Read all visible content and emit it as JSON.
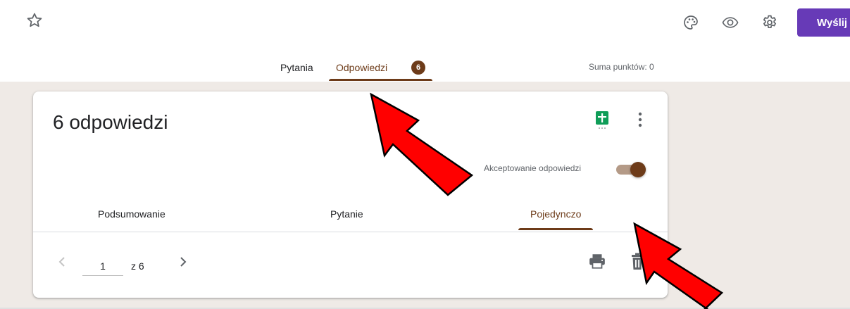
{
  "toolbar": {
    "send_label": "Wyślij",
    "icons": [
      "star-icon",
      "palette-icon",
      "eye-icon",
      "gear-icon"
    ],
    "accent_color": "#673ab7"
  },
  "tabs": {
    "questions_label": "Pytania",
    "responses_label": "Odpowiedzi",
    "responses_badge": "6",
    "points_label": "Suma punktów: 0",
    "theme_color": "#6d3b19"
  },
  "card": {
    "title": "6 odpowiedzi",
    "accepting_label": "Akceptowanie odpowiedzi",
    "accepting_on": true,
    "subtabs": {
      "summary": "Podsumowanie",
      "question": "Pytanie",
      "individual": "Pojedynczo"
    },
    "pagination": {
      "current": "1",
      "of_label": "z 6"
    }
  },
  "annotations": {
    "arrow_color": "#ff0000"
  }
}
